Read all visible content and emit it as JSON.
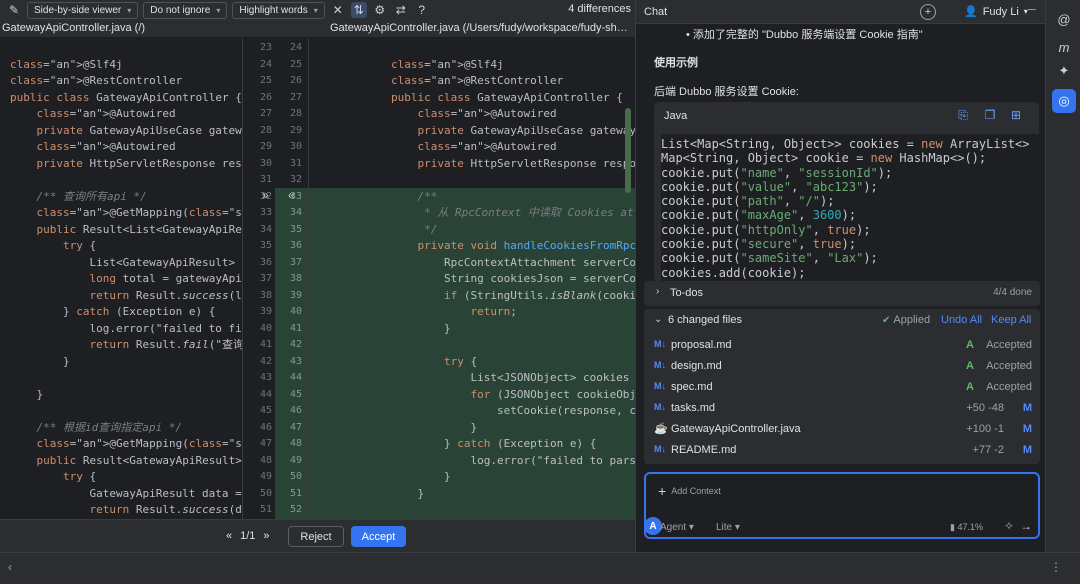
{
  "toolbar": {
    "viewer": "Side-by-side viewer",
    "ignore": "Do not ignore",
    "highlight": "Highlight words",
    "differences": "4 differences"
  },
  "files": {
    "left": "GatewayApiController.java (/)",
    "right": "GatewayApiController.java (/Users/fudy/workspace/fudy-shop-g..."
  },
  "gutter_numbers": {
    "left": [
      "23",
      "24",
      "25",
      "26",
      "27",
      "28",
      "29",
      "30",
      "31",
      "32",
      "33",
      "34",
      "35",
      "36",
      "37",
      "38",
      "39",
      "40",
      "41",
      "42",
      "43",
      "44",
      "45",
      "46",
      "47",
      "48",
      "49",
      "50",
      "51"
    ],
    "right": [
      "24",
      "25",
      "26",
      "27",
      "28",
      "29",
      "30",
      "31",
      "32",
      "33",
      "34",
      "35",
      "36",
      "37",
      "38",
      "39",
      "40",
      "41",
      "42",
      "43",
      "44",
      "45",
      "46",
      "47",
      "48",
      "49",
      "50",
      "51",
      "52"
    ]
  },
  "left_code": [
    "",
    "@Slf4j",
    "@RestController",
    "public class GatewayApiController {",
    "    @Autowired",
    "    private GatewayApiUseCase gatewayAp",
    "    @Autowired",
    "    private HttpServletResponse respons",
    "",
    "    /** 查询所有api */",
    "    @GetMapping(\"/apis\")",
    "    public Result<List<GatewayApiResult",
    "        try {",
    "            List<GatewayApiResult> list",
    "            long total = gatewayApiUseC",
    "            return Result.success(list,",
    "        } catch (Exception e) {",
    "            log.error(\"failed to find a",
    "            return Result.fail(\"查询失败",
    "        }",
    "",
    "    }",
    "",
    "    /** 根据id查询指定api */",
    "    @GetMapping(\"/apis/{id}\")",
    "    public Result<GatewayApiResult> fin",
    "        try {",
    "            GatewayApiResult data = gat",
    "            return Result.success(data)"
  ],
  "right_code": [
    "",
    "@Slf4j",
    "@RestController",
    "public class GatewayApiController {",
    "    @Autowired",
    "    private GatewayApiUseCase gatewayAp",
    "    @Autowired",
    "    private HttpServletResponse response",
    "",
    "    /**",
    "     * 从 RpcContext 中读取 Cookies attac",
    "     */",
    "    private void handleCookiesFromRpcCo",
    "        RpcContextAttachment serverConte",
    "        String cookiesJson = serverConte",
    "        if (StringUtils.isBlank(cookiesJs",
    "            return;",
    "        }",
    "",
    "        try {",
    "            List<JSONObject> cookies = JS",
    "            for (JSONObject cookieObj : c",
    "                setCookie(response, cooki",
    "            }",
    "        } catch (Exception e) {",
    "            log.error(\"failed to parse co",
    "        }",
    "    }",
    ""
  ],
  "pager": "1/1",
  "buttons": {
    "reject": "Reject",
    "accept": "Accept"
  },
  "chat": {
    "title": "Chat",
    "user": "Fudy Li",
    "bullet": "添加了完整的 \"Dubbo 服务端设置 Cookie 指南\"",
    "section_title": "使用示例",
    "desc": "后端 Dubbo 服务设置 Cookie:",
    "code_lang": "Java",
    "code_lines": [
      "List<Map<String, Object>> cookies = new ArrayList<>",
      "Map<String, Object> cookie = new HashMap<>();",
      "cookie.put(\"name\", \"sessionId\");",
      "cookie.put(\"value\", \"abc123\");",
      "cookie.put(\"path\", \"/\");",
      "cookie.put(\"maxAge\", 3600);",
      "cookie.put(\"httpOnly\", true);",
      "cookie.put(\"secure\", true);",
      "cookie.put(\"sameSite\", \"Lax\");",
      "cookies.add(cookie);"
    ],
    "todos_label": "To-dos",
    "todos_count": "4/4 done",
    "changed_label": "6 changed files",
    "applied": "Applied",
    "undo_all": "Undo All",
    "keep_all": "Keep All",
    "changed_files": [
      {
        "name": "proposal.md",
        "status": "A",
        "note": "Accepted",
        "icon": "markdown-icon"
      },
      {
        "name": "design.md",
        "status": "A",
        "note": "Accepted",
        "icon": "markdown-icon"
      },
      {
        "name": "spec.md",
        "status": "A",
        "note": "Accepted",
        "icon": "markdown-icon"
      },
      {
        "name": "tasks.md",
        "status": "M",
        "diff": "+50 -48",
        "icon": "markdown-icon"
      },
      {
        "name": "GatewayApiController.java",
        "status": "M",
        "diff": "+100 -1",
        "icon": "java-icon"
      },
      {
        "name": "README.md",
        "status": "M",
        "diff": "+77 -2",
        "icon": "markdown-icon"
      }
    ],
    "input_placeholder": "Add Context",
    "agent_mode": "Agent",
    "model": "Lite",
    "context_pct": "47.1%",
    "avatar_letter": "A"
  },
  "colors": {
    "accent": "#3574f0",
    "added_bg": "#294436",
    "added_status": "#5fb865",
    "modified_status": "#548af7"
  }
}
